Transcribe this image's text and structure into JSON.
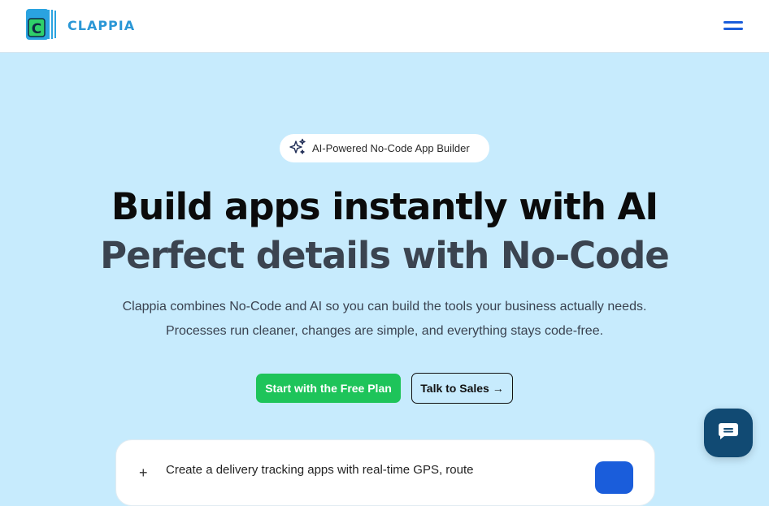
{
  "colors": {
    "page_background": "#c7ebfd",
    "header_background": "#ffffff",
    "brand_blue": "#2a97d6",
    "accent_blue": "#1a5ddb",
    "cta_green": "#1ec45a",
    "chat_button": "#114a73"
  },
  "header": {
    "brand_name": "CLAPPIA",
    "logo_letter": "C",
    "logo_icon": "clappia-logo-icon",
    "menu_icon": "hamburger-menu-icon"
  },
  "hero": {
    "badge_icon": "sparkles-icon",
    "badge_text": "AI-Powered No-Code App Builder",
    "headline_line1": "Build apps instantly with AI",
    "headline_line2": "Perfect details with No-Code",
    "subtext_line1": "Clappia combines No-Code and AI so you can build the tools your business actually needs.",
    "subtext_line2": "Processes run cleaner, changes are simple, and everything stays code-free.",
    "primary_cta": "Start with the Free Plan",
    "secondary_cta": "Talk to Sales →"
  },
  "prompt": {
    "plus_label": "+",
    "text": "Create a delivery tracking apps with real-time GPS, route",
    "send_icon": "send-icon"
  },
  "chat": {
    "icon": "chat-bubble-icon"
  }
}
